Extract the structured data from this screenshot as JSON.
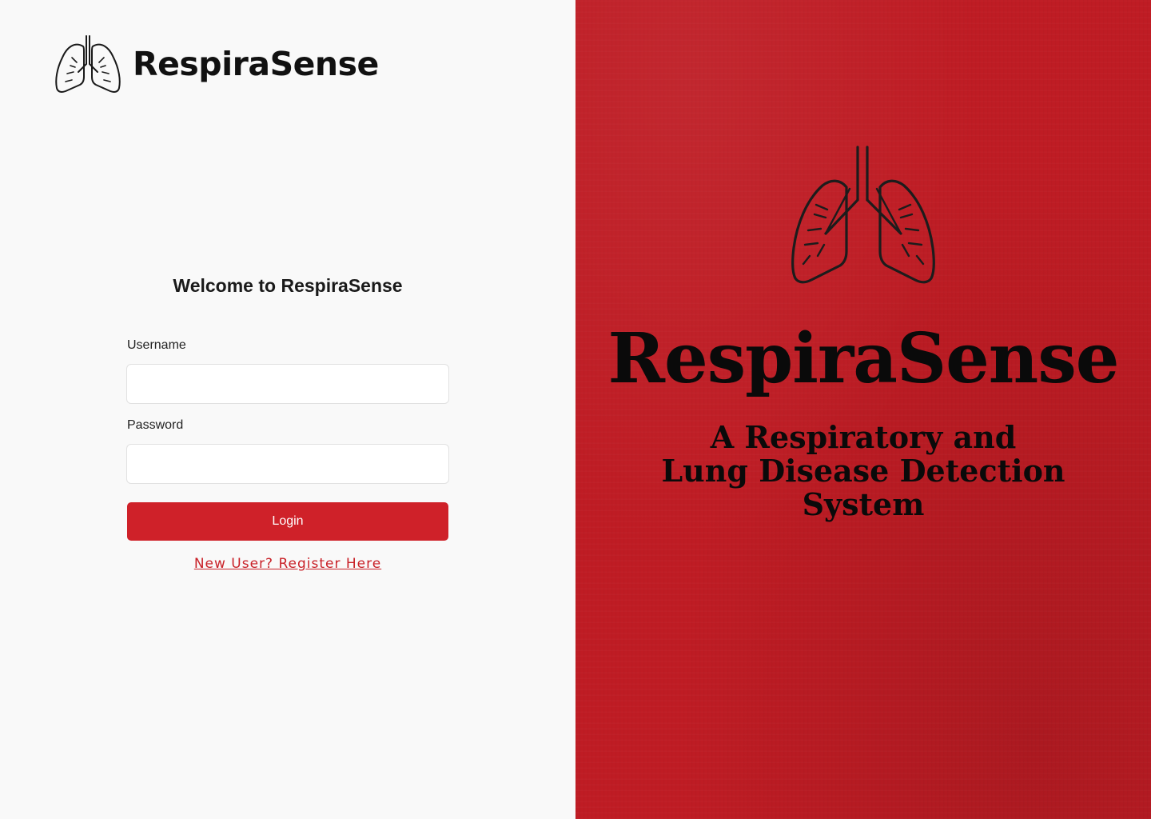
{
  "brand": {
    "name": "RespiraSense",
    "logo_icon": "lungs-icon"
  },
  "login": {
    "heading": "Welcome to RespiraSense",
    "username_label": "Username",
    "username_value": "",
    "password_label": "Password",
    "password_value": "",
    "login_button": "Login",
    "register_link": "New User? Register Here"
  },
  "hero": {
    "title": "RespiraSense",
    "tagline_line1": "A Respiratory and",
    "tagline_line2": "Lung Disease Detection",
    "tagline_line3": "System",
    "logo_icon": "lungs-icon"
  },
  "colors": {
    "accent": "#cf2129",
    "hero_background": "#bf1c24",
    "page_background": "#f9f9f9",
    "text": "#111111"
  }
}
